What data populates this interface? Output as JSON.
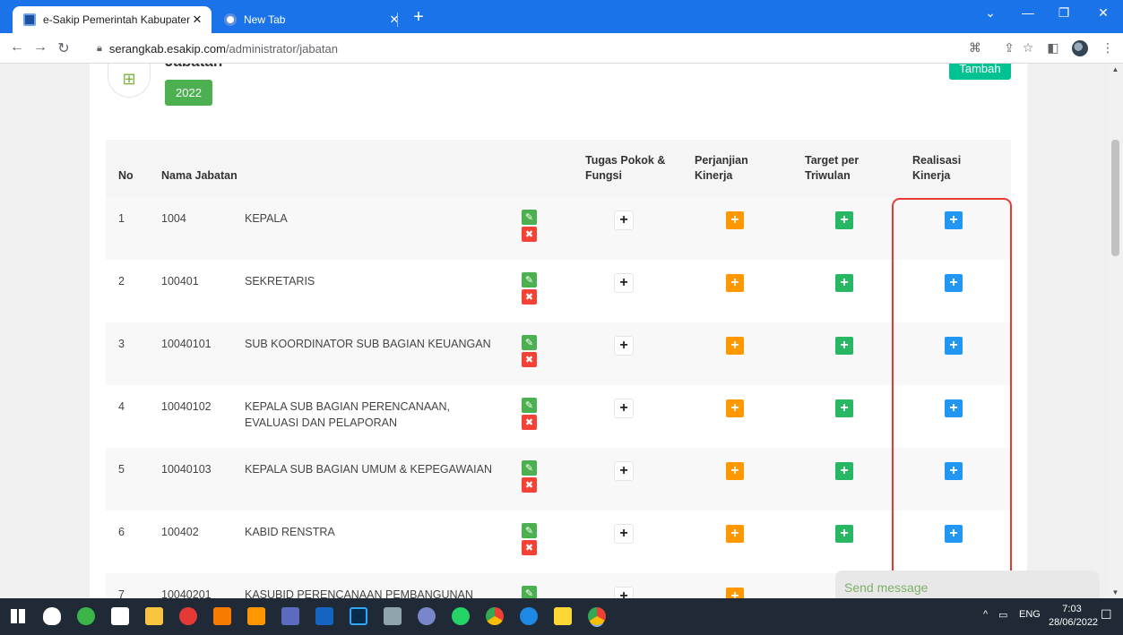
{
  "browser": {
    "tabs": [
      {
        "title": "e-Sakip Pemerintah Kabupaten S"
      },
      {
        "title": "New Tab"
      }
    ],
    "new_tab_symbol": "+",
    "close_symbol": "✕",
    "url_host": "serangkab.esakip.com",
    "url_path": "/administrator/jabatan"
  },
  "page": {
    "title": "Jabatan",
    "year": "2022",
    "add_button": "Tambah",
    "icon": "grid-add-icon"
  },
  "table": {
    "headers": {
      "no": "No",
      "nama": "Nama Jabatan",
      "tupoksi": "Tugas Pokok & Fungsi",
      "perjanjian": "Perjanjian Kinerja",
      "target": "Target per Triwulan",
      "realisasi": "Realisasi Kinerja"
    },
    "rows": [
      {
        "no": "1",
        "code": "1004",
        "name": "KEPALA"
      },
      {
        "no": "2",
        "code": "100401",
        "name": "SEKRETARIS"
      },
      {
        "no": "3",
        "code": "10040101",
        "name": "SUB KOORDINATOR SUB BAGIAN KEUANGAN"
      },
      {
        "no": "4",
        "code": "10040102",
        "name": "KEPALA SUB BAGIAN PERENCANAAN, EVALUASI DAN PELAPORAN"
      },
      {
        "no": "5",
        "code": "10040103",
        "name": "KEPALA SUB BAGIAN UMUM & KEPEGAWAIAN"
      },
      {
        "no": "6",
        "code": "100402",
        "name": "KABID RENSTRA"
      },
      {
        "no": "7",
        "code": "10040201",
        "name": "KASUBID PERENCANAAN PEMBANGUNAN"
      }
    ],
    "symbols": {
      "edit": "✎",
      "delete": "✖",
      "plus": "+"
    }
  },
  "chat": {
    "label": "Send message"
  },
  "taskbar": {
    "lang": "ENG",
    "time": "7:03",
    "date": "28/06/2022"
  },
  "colors": {
    "accent": "#1a73e8",
    "edit": "#4caf50",
    "delete": "#f44336",
    "tupoksi": "#ffffff",
    "perjanjian": "#ff9800",
    "target": "#28b864",
    "realisasi": "#2196f3",
    "highlight": "#e53935"
  }
}
